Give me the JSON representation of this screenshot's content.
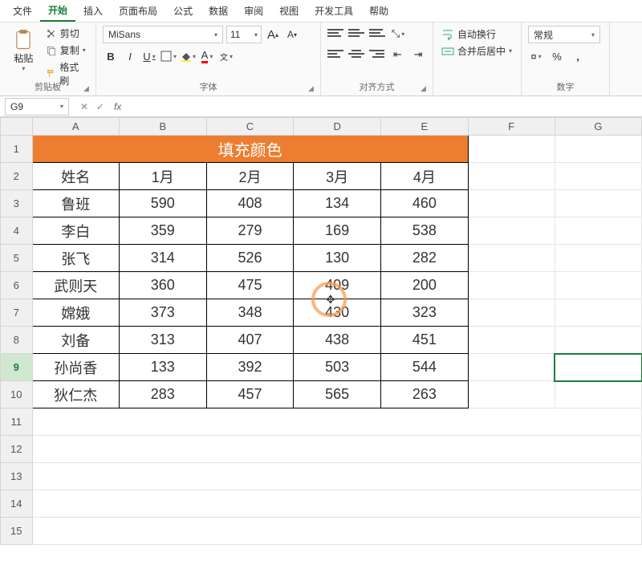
{
  "menu": {
    "tabs": [
      "文件",
      "开始",
      "插入",
      "页面布局",
      "公式",
      "数据",
      "审阅",
      "视图",
      "开发工具",
      "帮助"
    ],
    "active_index": 1
  },
  "ribbon": {
    "clipboard": {
      "paste": "粘贴",
      "cut": "剪切",
      "copy": "复制",
      "format_painter": "格式刷",
      "group_label": "剪贴板"
    },
    "font": {
      "name": "MiSans",
      "size": "11",
      "grow": "A",
      "shrink": "A",
      "bold": "B",
      "italic": "I",
      "underline": "U",
      "wen": "wen",
      "wen2": "文",
      "group_label": "字体"
    },
    "align": {
      "group_label": "对齐方式"
    },
    "wrap": {
      "auto_wrap": "自动换行",
      "merge_center": "合并后居中"
    },
    "number": {
      "format": "常规",
      "currency": "%",
      "comma": ",",
      "group_label": "数字"
    }
  },
  "namebox": {
    "cell_ref": "G9",
    "fx": "fx"
  },
  "sheet": {
    "columns": [
      "A",
      "B",
      "C",
      "D",
      "E",
      "F",
      "G"
    ],
    "title": "填充颜色",
    "headers": [
      "姓名",
      "1月",
      "2月",
      "3月",
      "4月"
    ],
    "rows": [
      {
        "r": "1"
      },
      {
        "r": "2"
      },
      {
        "r": "3",
        "cells": [
          "鲁班",
          "590",
          "408",
          "134",
          "460"
        ]
      },
      {
        "r": "4",
        "cells": [
          "李白",
          "359",
          "279",
          "169",
          "538"
        ]
      },
      {
        "r": "5",
        "cells": [
          "张飞",
          "314",
          "526",
          "130",
          "282"
        ]
      },
      {
        "r": "6",
        "cells": [
          "武则天",
          "360",
          "475",
          "409",
          "200"
        ]
      },
      {
        "r": "7",
        "cells": [
          "嫦娥",
          "373",
          "348",
          "430",
          "323"
        ]
      },
      {
        "r": "8",
        "cells": [
          "刘备",
          "313",
          "407",
          "438",
          "451"
        ]
      },
      {
        "r": "9",
        "cells": [
          "孙尚香",
          "133",
          "392",
          "503",
          "544"
        ]
      },
      {
        "r": "10",
        "cells": [
          "狄仁杰",
          "283",
          "457",
          "565",
          "263"
        ]
      },
      {
        "r": "11"
      },
      {
        "r": "12"
      },
      {
        "r": "13"
      },
      {
        "r": "14"
      },
      {
        "r": "15"
      }
    ],
    "selected_cell": "G9",
    "selected_row": 9
  },
  "chart_data": {
    "type": "table",
    "title": "填充颜色",
    "columns": [
      "姓名",
      "1月",
      "2月",
      "3月",
      "4月"
    ],
    "rows": [
      [
        "鲁班",
        590,
        408,
        134,
        460
      ],
      [
        "李白",
        359,
        279,
        169,
        538
      ],
      [
        "张飞",
        314,
        526,
        130,
        282
      ],
      [
        "武则天",
        360,
        475,
        409,
        200
      ],
      [
        "嫦娥",
        373,
        348,
        430,
        323
      ],
      [
        "刘备",
        313,
        407,
        438,
        451
      ],
      [
        "孙尚香",
        133,
        392,
        503,
        544
      ],
      [
        "狄仁杰",
        283,
        457,
        565,
        263
      ]
    ]
  }
}
